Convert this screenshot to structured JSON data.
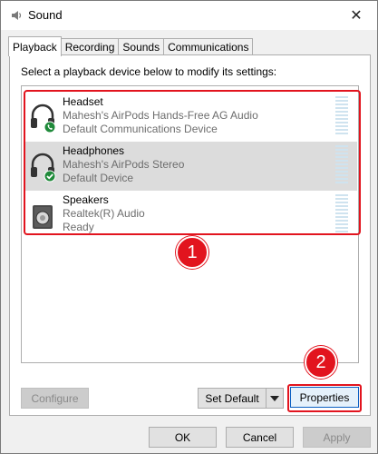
{
  "window": {
    "title": "Sound",
    "close_glyph": "✕"
  },
  "tabs": [
    {
      "label": "Playback",
      "active": true
    },
    {
      "label": "Recording",
      "active": false
    },
    {
      "label": "Sounds",
      "active": false
    },
    {
      "label": "Communications",
      "active": false
    }
  ],
  "instruction": "Select a playback device below to modify its settings:",
  "devices": [
    {
      "name": "Headset",
      "description": "Mahesh's AirPods Hands-Free AG Audio",
      "status": "Default Communications Device",
      "icon": "headset-icon",
      "status_icon": "phone-check-icon",
      "selected": false
    },
    {
      "name": "Headphones",
      "description": "Mahesh's AirPods Stereo",
      "status": "Default Device",
      "icon": "headphones-icon",
      "status_icon": "green-check-icon",
      "selected": true
    },
    {
      "name": "Speakers",
      "description": "Realtek(R) Audio",
      "status": "Ready",
      "icon": "speakers-icon",
      "status_icon": "",
      "selected": false
    }
  ],
  "buttons": {
    "configure": "Configure",
    "set_default": "Set Default",
    "properties": "Properties",
    "ok": "OK",
    "cancel": "Cancel",
    "apply": "Apply"
  },
  "annotations": {
    "badge_1": "1",
    "badge_2": "2"
  },
  "colors": {
    "annotation_red": "#e2141e",
    "status_green": "#1f8a3a",
    "meter": "#cfe3ef",
    "selection": "#dcdcdc"
  }
}
